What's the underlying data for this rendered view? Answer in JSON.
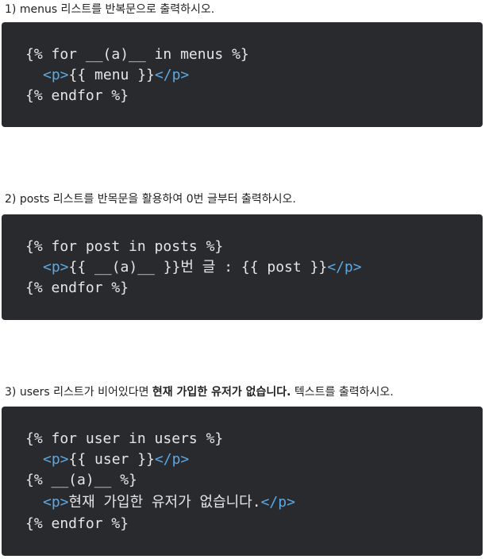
{
  "questions": [
    {
      "prefix": "1)  menus 리스트를 반복문으로 출력하시오.",
      "code": [
        {
          "text": "{% for __(a)__ in menus %}"
        },
        {
          "open": "<p>",
          "text": "{{ menu }}",
          "close": "</p>"
        },
        {
          "text": "{% endfor %}"
        }
      ]
    },
    {
      "prefix": "2)  posts 리스트를 반목문을 활용하여 0번 글부터 출력하시오.",
      "code": [
        {
          "text": "{% for post in posts %}"
        },
        {
          "open": "<p>",
          "text": "{{ __(a)__ }}번 글 : {{ post }}",
          "close": "</p>"
        },
        {
          "text": "{% endfor %}"
        }
      ]
    },
    {
      "prefix": "3)  users 리스트가 비어있다면 ",
      "bold": "현재 가입한 유저가 없습니다.",
      "suffix": " 텍스트를 출력하시오.",
      "code": [
        {
          "text": "{% for user in users %}"
        },
        {
          "open": "<p>",
          "text": "{{ user }}",
          "close": "</p>"
        },
        {
          "text": "{% __(a)__ %}"
        },
        {
          "open": "<p>",
          "text": "현재 가입한 유저가 없습니다.",
          "close": "</p>"
        },
        {
          "text": "{% endfor %}"
        }
      ]
    }
  ]
}
